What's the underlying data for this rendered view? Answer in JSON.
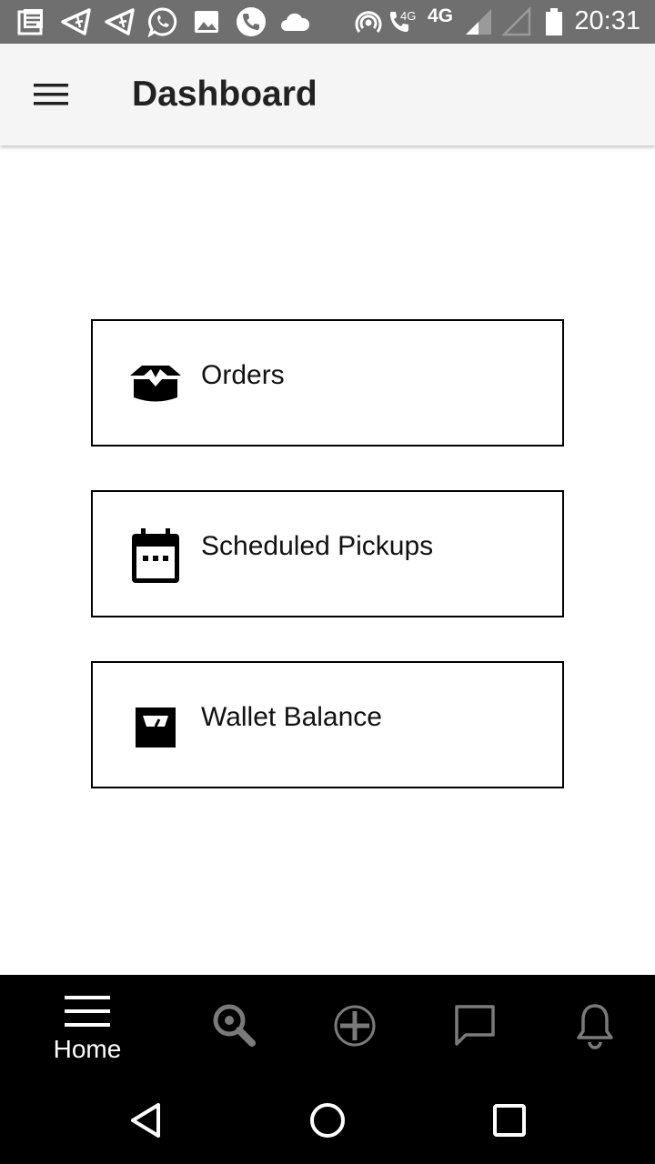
{
  "status_bar": {
    "time": "20:31",
    "network_small": "4G",
    "network": "4G",
    "icons": [
      "notes-icon",
      "navigation-icon",
      "navigation-icon",
      "whatsapp-icon",
      "image-icon",
      "phone-icon",
      "cloud-icon",
      "hotspot-icon",
      "volte-call-icon",
      "signal-icon",
      "signal-empty-icon",
      "battery-icon"
    ]
  },
  "app_bar": {
    "title": "Dashboard",
    "menu_icon": "hamburger-menu-icon"
  },
  "cards": [
    {
      "label": "Orders",
      "icon": "open-box-icon"
    },
    {
      "label": "Scheduled Pickups",
      "icon": "calendar-icon"
    },
    {
      "label": "Wallet Balance",
      "icon": "weighing-scale-icon"
    }
  ],
  "tab_bar": {
    "tabs": [
      {
        "label": "Home",
        "icon": "hamburger-menu-icon",
        "active": true
      },
      {
        "label": "",
        "icon": "search-location-icon"
      },
      {
        "label": "",
        "icon": "add-circle-icon"
      },
      {
        "label": "",
        "icon": "chat-bubble-icon"
      },
      {
        "label": "",
        "icon": "bell-icon"
      }
    ]
  },
  "nav_bar": {
    "buttons": [
      "back-triangle-icon",
      "home-circle-icon",
      "recents-square-icon"
    ]
  },
  "colors": {
    "status_bar": "#6f6f6f",
    "app_bar": "#f5f5f5",
    "tab_bar": "#000000",
    "inactive_tab_icon": "#7a7a7a"
  }
}
